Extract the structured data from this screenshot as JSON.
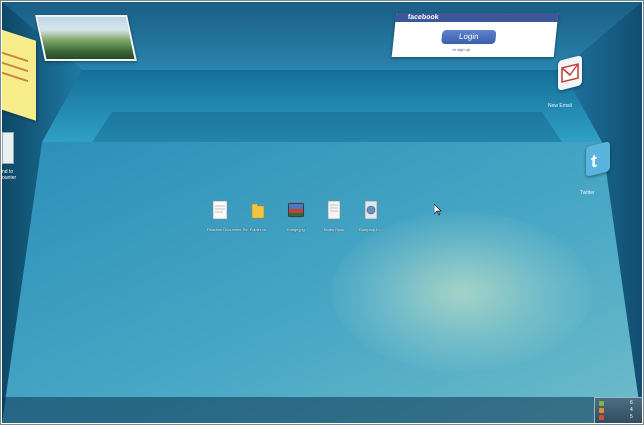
{
  "facebook": {
    "header": "facebook",
    "login_label": "Login",
    "signup_label": "or sign up"
  },
  "wall_widgets": {
    "email_label": "New Email",
    "twitter_label": "Twitter",
    "left_label_1": "nd to",
    "left_label_2": "ounter"
  },
  "desktop_icons": [
    {
      "label": "Readme.Document.Re...",
      "icon": "document-icon"
    },
    {
      "label": "Folder.xe",
      "icon": "folder-icon"
    },
    {
      "label": "Image.jpg",
      "icon": "image-icon"
    },
    {
      "label": "Notes.Book",
      "icon": "notebook-icon"
    },
    {
      "label": "Bumptop.In...",
      "icon": "settings-file-icon"
    }
  ],
  "tray": {
    "row1": "6",
    "row2": "4",
    "row3": "5"
  },
  "colors": {
    "facebook_blue": "#3b5998",
    "room_teal": "#2f8fb2",
    "sticky_yellow": "#f6ec8a"
  }
}
